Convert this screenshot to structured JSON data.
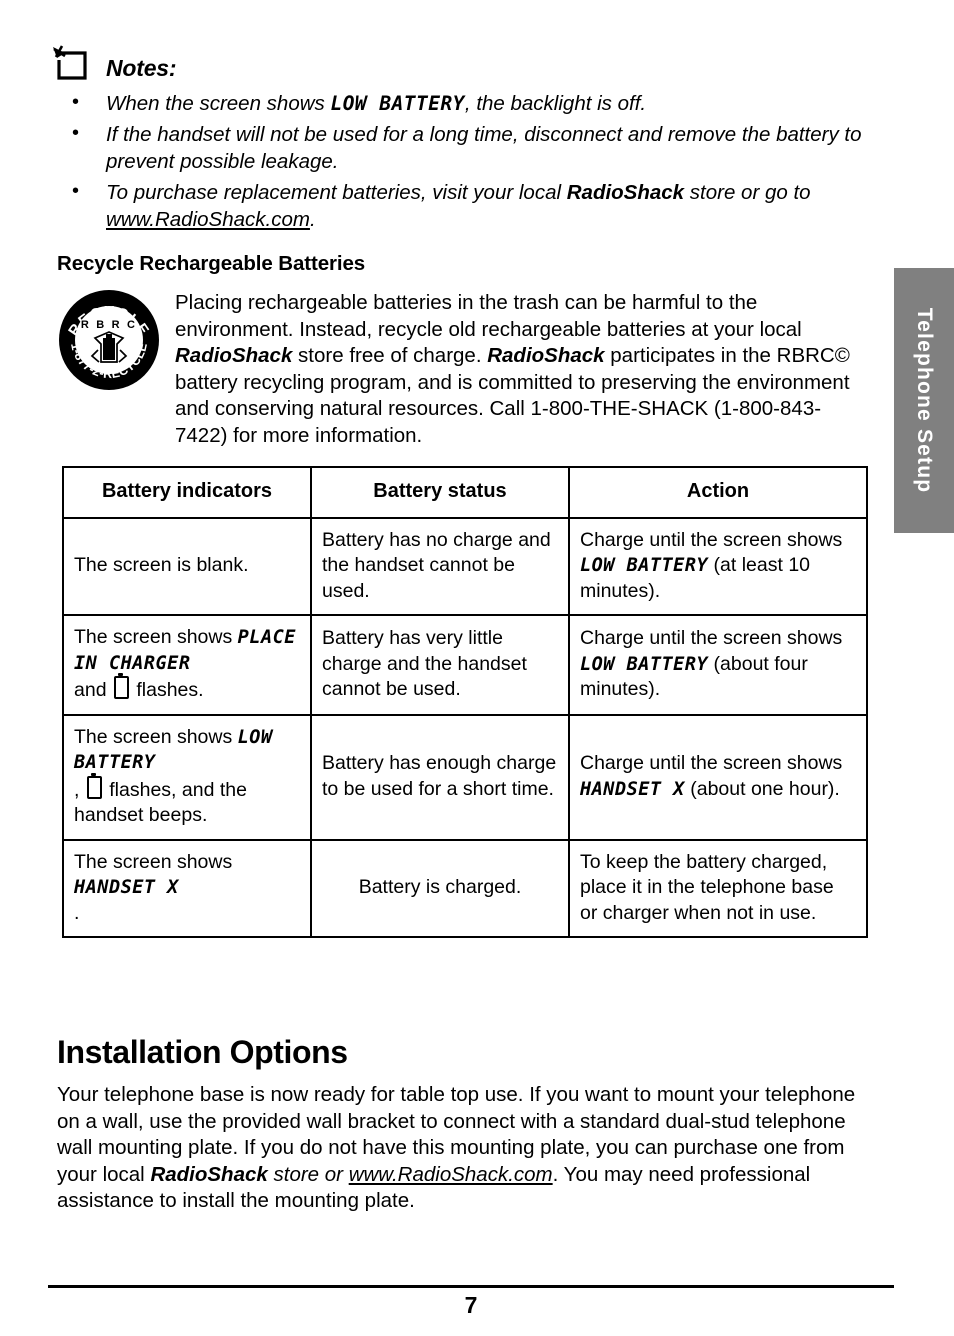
{
  "side_tab": {
    "label": "Telephone Setup",
    "background_color": "#808080",
    "text_color": "#ffffff"
  },
  "notes": {
    "icon": "note-pushpin-icon",
    "title": "Notes:",
    "items": [
      {
        "parts": [
          {
            "type": "text",
            "value": "When the screen shows "
          },
          {
            "type": "lcd",
            "value": "LOW BATTERY"
          },
          {
            "type": "text",
            "value": ", the backlight is off."
          }
        ]
      },
      {
        "parts": [
          {
            "type": "text",
            "value": "If the handset will not be used for a long time, disconnect and remove the battery to prevent possible leakage."
          }
        ]
      },
      {
        "parts": [
          {
            "type": "text",
            "value": "To purchase replacement batteries, visit your local "
          },
          {
            "type": "bold",
            "value": "RadioShack"
          },
          {
            "type": "text",
            "value": " store or go to "
          },
          {
            "type": "underline",
            "value": "www.RadioShack.com"
          },
          {
            "type": "text",
            "value": "."
          }
        ]
      }
    ]
  },
  "recycle": {
    "heading": "Recycle Rechargeable Batteries",
    "logo": {
      "name": "rbrc-recycle-logo",
      "top_text": "RECYCLE",
      "bottom_text": "1-877-2-RECYCLE",
      "inner_text": "R B R C"
    },
    "paragraph_parts": [
      {
        "type": "text",
        "value": "Placing rechargeable batteries in the trash can be harmful to the environment. Instead, recycle old rechargeable batteries at your local "
      },
      {
        "type": "bold",
        "value": "RadioShack"
      },
      {
        "type": "text",
        "value": " store free of charge. "
      },
      {
        "type": "bold",
        "value": "RadioShack"
      },
      {
        "type": "text",
        "value": " participates in the RBRC© battery recycling program, and is committed to preserving the environment and conserving natural resources. Call 1-800-THE-SHACK (1-800-843-7422) for more information."
      }
    ]
  },
  "battery_table": {
    "headers": [
      "Battery indicators",
      "Battery status",
      "Action"
    ],
    "rows": [
      {
        "indicator_parts": [
          {
            "type": "text",
            "value": "The screen is blank."
          }
        ],
        "status_parts": [
          {
            "type": "text",
            "value": "Battery has no charge and the handset cannot be used."
          }
        ],
        "action_parts": [
          {
            "type": "text",
            "value": "Charge until the screen shows "
          },
          {
            "type": "lcd",
            "value": "LOW BATTERY"
          },
          {
            "type": "text",
            "value": " (at least 10 minutes)."
          }
        ]
      },
      {
        "indicator_parts": [
          {
            "type": "text",
            "value": "The screen shows "
          },
          {
            "type": "lcd-block",
            "value": "PLACE IN CHARGER"
          },
          {
            "type": "text",
            "value": "and "
          },
          {
            "type": "battery-icon",
            "value": ""
          },
          {
            "type": "text",
            "value": " flashes."
          }
        ],
        "status_parts": [
          {
            "type": "text",
            "value": "Battery has very little charge and the handset cannot be used."
          }
        ],
        "action_parts": [
          {
            "type": "text",
            "value": "Charge until the screen shows "
          },
          {
            "type": "lcd",
            "value": "LOW BATTERY"
          },
          {
            "type": "text",
            "value": " (about four minutes)."
          }
        ]
      },
      {
        "indicator_parts": [
          {
            "type": "text",
            "value": "The screen shows "
          },
          {
            "type": "lcd-block",
            "value": "LOW BATTERY"
          },
          {
            "type": "text",
            "value": ", "
          },
          {
            "type": "battery-icon",
            "value": ""
          },
          {
            "type": "text",
            "value": " flashes, and the handset beeps."
          }
        ],
        "status_parts": [
          {
            "type": "text",
            "value": "Battery has enough charge to be used for a short time."
          }
        ],
        "action_parts": [
          {
            "type": "text",
            "value": "Charge until the screen shows "
          },
          {
            "type": "lcd",
            "value": "HANDSET X"
          },
          {
            "type": "text",
            "value": " (about one hour)."
          }
        ]
      },
      {
        "indicator_parts": [
          {
            "type": "text",
            "value": "The screen shows "
          },
          {
            "type": "lcd-block",
            "value": "HANDSET X"
          },
          {
            "type": "text",
            "value": "."
          }
        ],
        "status_parts": [
          {
            "type": "text",
            "value": "Battery is charged."
          }
        ],
        "action_parts": [
          {
            "type": "text",
            "value": "To keep the battery charged, place it in the telephone base or charger when not in use."
          }
        ]
      }
    ]
  },
  "installation": {
    "heading": "Installation Options",
    "paragraph_parts": [
      {
        "type": "text",
        "value": "Your telephone base is now ready for table top use. If you want to mount your telephone on a wall, use the provided wall bracket to connect with a standard dual-stud telephone wall mounting plate. If you do not have this mounting plate, you can purchase one from your local "
      },
      {
        "type": "bold",
        "value": "RadioShack"
      },
      {
        "type": "italic",
        "value": " store or "
      },
      {
        "type": "underline-italic",
        "value": "www.RadioShack.com"
      },
      {
        "type": "text",
        "value": ". You may need professional assistance to install the mounting plate."
      }
    ]
  },
  "footer": {
    "page_number": "7"
  }
}
